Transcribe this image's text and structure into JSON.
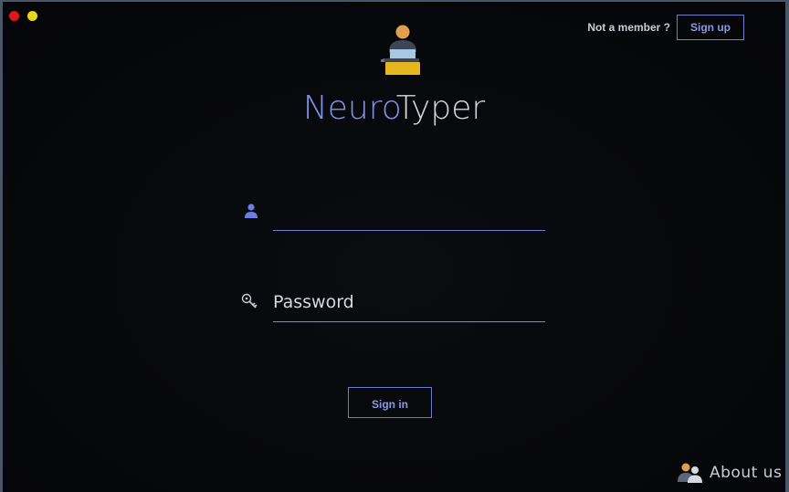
{
  "window": {
    "controls": [
      "close",
      "minimize"
    ],
    "colors": {
      "close": "#e0161b",
      "minimize": "#e6d817"
    }
  },
  "header": {
    "not_member_text": "Not a member ?",
    "signup_label": "Sign up"
  },
  "app": {
    "logo_icon": "typist-logo-icon",
    "title_part1": "Neuro",
    "title_part2": "Typer",
    "colors": {
      "accent": "#7f93ea",
      "title_light": "#d5d8de"
    }
  },
  "login": {
    "username_value": "",
    "username_placeholder": "",
    "username_icon": "user-icon",
    "password_value": "",
    "password_placeholder": "Password",
    "password_icon": "key-icon",
    "signin_label": "Sign in"
  },
  "footer": {
    "about_icon": "people-icon",
    "about_label": "About us"
  }
}
